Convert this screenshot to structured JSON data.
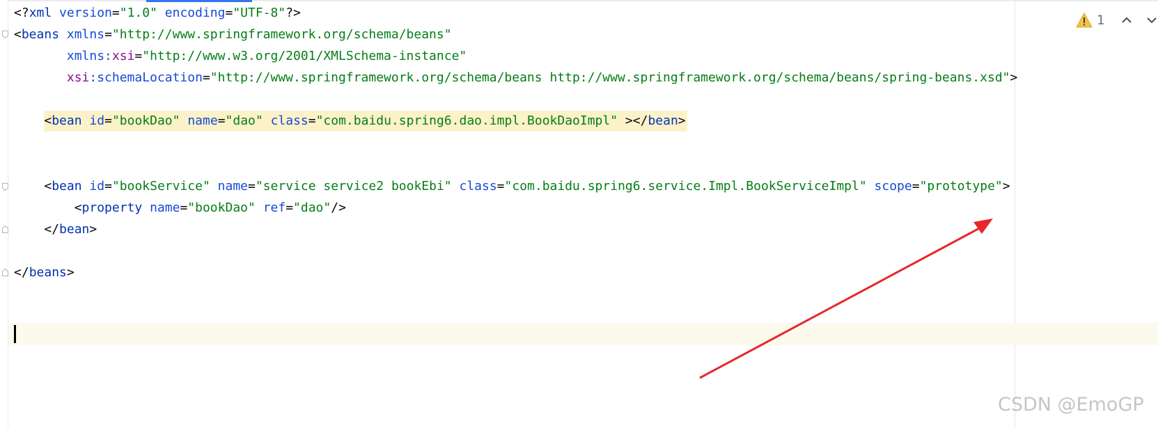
{
  "editor": {
    "language": "XML",
    "lines": {
      "l1": {
        "open": "<?",
        "tag": "xml",
        "a1": "version",
        "eq1": "=",
        "v1": "\"1.0\"",
        "a2": "encoding",
        "eq2": "=",
        "v2": "\"UTF-8\"",
        "close": "?>"
      },
      "l2": {
        "open": "<",
        "tag": "beans",
        "a1": "xmlns",
        "eq1": "=",
        "v1": "\"http://www.springframework.org/schema/beans\""
      },
      "l3": {
        "indent": "       ",
        "a1": "xmlns:",
        "ns1": "xsi",
        "eq1": "=",
        "v1": "\"http://www.w3.org/2001/XMLSchema-instance\""
      },
      "l4": {
        "indent": "       ",
        "ns1": "xsi",
        "a1": ":schemaLocation",
        "eq1": "=",
        "v1": "\"http://www.springframework.org/schema/beans http://www.springframework.org/schema/beans/spring-beans.xsd\"",
        "close": ">"
      },
      "l5": {
        "open": "<",
        "tag": "bean",
        "a1": "id",
        "eq1": "=",
        "v1": "\"bookDao\"",
        "a2": "name",
        "eq2": "=",
        "v2": "\"dao\"",
        "a3": "class",
        "eq3": "=",
        "v3": "\"com.baidu.spring6.dao.impl.BookDaoImpl\"",
        "mid": " ></",
        "tag2": "bean",
        "close": ">"
      },
      "l6": {
        "open": "<",
        "tag": "bean",
        "a1": "id",
        "eq1": "=",
        "v1": "\"bookService\"",
        "a2": "name",
        "eq2": "=",
        "v2": "\"service service2 bookEbi\"",
        "a3": "class",
        "eq3": "=",
        "v3": "\"com.baidu.spring6.service.Impl.BookServiceImpl\"",
        "a4": "scope",
        "eq4": "=",
        "v4": "\"prototype\"",
        "close": ">"
      },
      "l7": {
        "open": "<",
        "tag": "property",
        "a1": "name",
        "eq1": "=",
        "v1": "\"bookDao\"",
        "a2": "ref",
        "eq2": "=",
        "v2": "\"dao\"",
        "close": "/>"
      },
      "l8": {
        "open": "</",
        "tag": "bean",
        "close": ">"
      },
      "l9": {
        "open": "</",
        "tag": "beans",
        "close": ">"
      }
    }
  },
  "inspection": {
    "icon": "warning-triangle-icon",
    "warning_count": "1"
  },
  "colors": {
    "tag": "#0033b3",
    "attribute": "#174ad4",
    "namespace": "#871094",
    "value": "#067d17",
    "highlight": "#fcf2c9",
    "caret_line": "#fcfaed",
    "annotation_arrow": "#e8262b"
  },
  "watermark": "CSDN @EmoGP"
}
